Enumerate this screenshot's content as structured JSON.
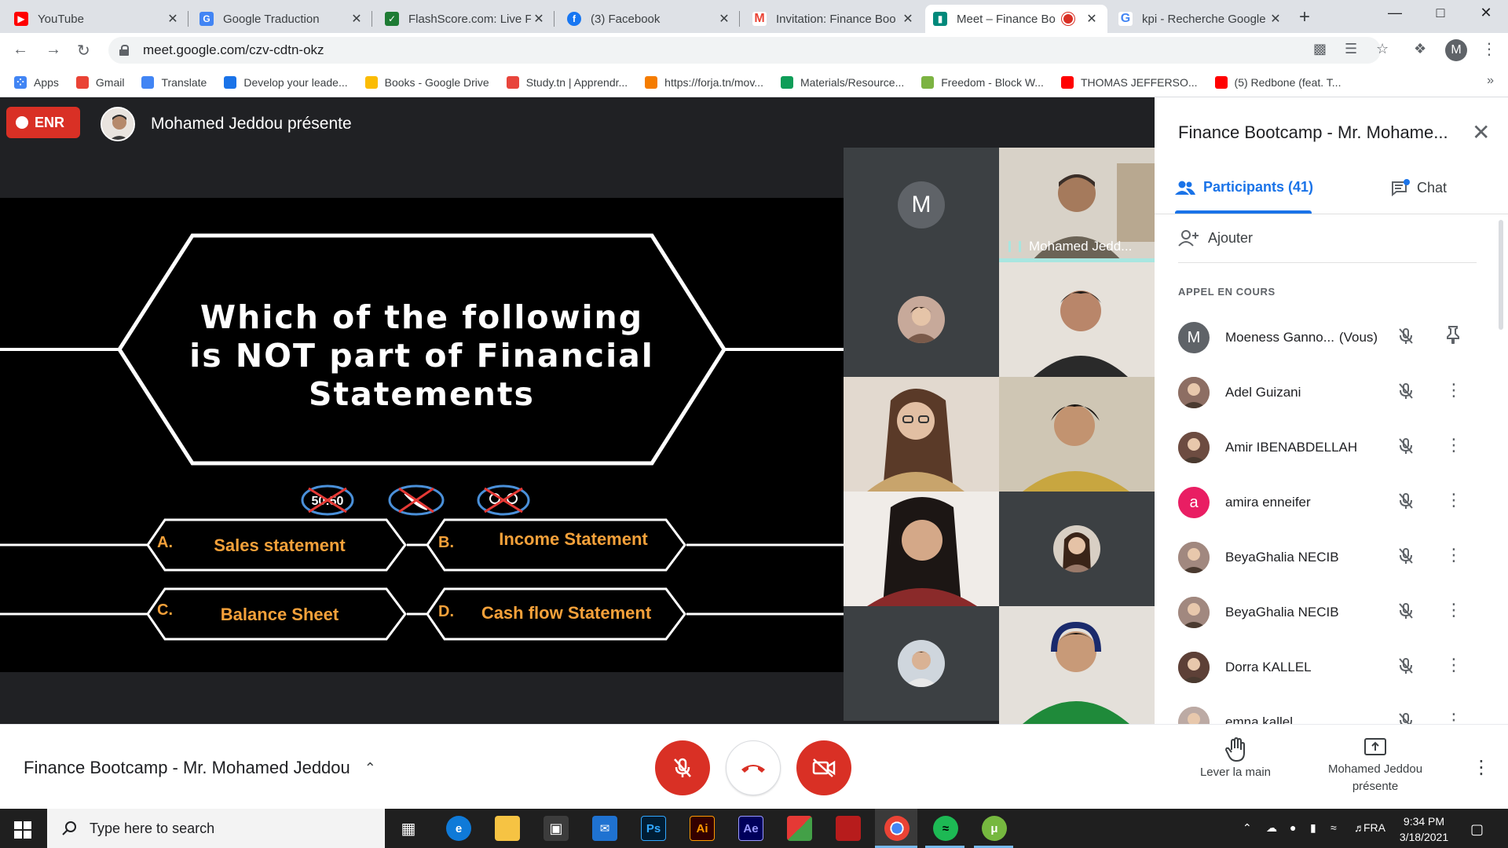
{
  "browser": {
    "tabs": [
      {
        "title": "YouTube",
        "icon": "youtube-icon",
        "color": "#ff0000"
      },
      {
        "title": "Google Traduction",
        "icon": "google-translate-icon",
        "color": "#4285f4"
      },
      {
        "title": "FlashScore.com: Live Fo",
        "icon": "flashscore-icon",
        "color": "#1e7b34"
      },
      {
        "title": "(3) Facebook",
        "icon": "facebook-icon",
        "color": "#1877f2"
      },
      {
        "title": "Invitation: Finance Boo",
        "icon": "gmail-icon",
        "color": "#ea4335"
      },
      {
        "title": "Meet – Finance Bo",
        "icon": "google-meet-icon",
        "color": "#00897b",
        "active": true,
        "recording": true
      },
      {
        "title": "kpi - Recherche Google",
        "icon": "google-icon",
        "color": "#4285f4"
      }
    ],
    "url": "meet.google.com/czv-cdtn-okz",
    "profile_initial": "M",
    "bookmarks": [
      {
        "label": "Apps",
        "icon": "apps-grid-icon",
        "color": "#4285f4"
      },
      {
        "label": "Gmail",
        "icon": "gmail-icon",
        "color": "#ea4335"
      },
      {
        "label": "Translate",
        "icon": "google-translate-icon",
        "color": "#4285f4"
      },
      {
        "label": "Develop your leade...",
        "icon": "develop-icon",
        "color": "#1a73e8"
      },
      {
        "label": "Books - Google Drive",
        "icon": "google-drive-icon",
        "color": "#fbbc04"
      },
      {
        "label": "Study.tn | Apprendr...",
        "icon": "study-icon",
        "color": "#e8453c"
      },
      {
        "label": "https://forja.tn/mov...",
        "icon": "forja-icon",
        "color": "#f57c00"
      },
      {
        "label": "Materials/Resource...",
        "icon": "materials-icon",
        "color": "#0f9d58"
      },
      {
        "label": "Freedom - Block W...",
        "icon": "freedom-icon",
        "color": "#7cb342"
      },
      {
        "label": "THOMAS JEFFERSO...",
        "icon": "youtube-icon",
        "color": "#ff0000"
      },
      {
        "label": "(5) Redbone (feat. T...",
        "icon": "youtube-icon",
        "color": "#ff0000"
      }
    ]
  },
  "meet": {
    "recording_label": "ENR",
    "presenting_text": "Mohamed Jeddou présente",
    "slide": {
      "question": "Which of the following is NOT part of Financial Statements",
      "lifelines": [
        "50:50"
      ],
      "answers": [
        {
          "letter": "A.",
          "text": "Sales statement"
        },
        {
          "letter": "B.",
          "text": "Income Statement"
        },
        {
          "letter": "C.",
          "text": "Balance Sheet"
        },
        {
          "letter": "D.",
          "text": "Cash flow Statement"
        }
      ]
    },
    "tiles": {
      "m_initial": "M",
      "speaker_name": "Mohamed Jedd..."
    },
    "panel": {
      "title": "Finance Bootcamp - Mr. Mohame...",
      "participants_tab": "Participants (41)",
      "chat_tab": "Chat",
      "add_label": "Ajouter",
      "section_label": "APPEL EN COURS",
      "participants": [
        {
          "name": "Moeness Ganno...",
          "suffix": "(Vous)",
          "avatar": "M",
          "avatar_color": "#5f6368",
          "action": "pin-icon"
        },
        {
          "name": "Adel Guizani",
          "avatar": "",
          "avatar_color": "#8d6e63",
          "action": "more-icon"
        },
        {
          "name": "Amir IBENABDELLAH",
          "avatar": "",
          "avatar_color": "#6d4c41",
          "action": "more-icon"
        },
        {
          "name": "amira enneifer",
          "avatar": "a",
          "avatar_color": "#e91e63",
          "action": "more-icon"
        },
        {
          "name": "BeyaGhalia NECIB",
          "avatar": "",
          "avatar_color": "#a1887f",
          "action": "more-icon"
        },
        {
          "name": "BeyaGhalia NECIB",
          "avatar": "",
          "avatar_color": "#a1887f",
          "action": "more-icon"
        },
        {
          "name": "Dorra KALLEL",
          "avatar": "",
          "avatar_color": "#5d4037",
          "action": "more-icon"
        },
        {
          "name": "emna kallel",
          "avatar": "",
          "avatar_color": "#bcaaa4",
          "action": "more-icon"
        }
      ]
    },
    "controls": {
      "meeting_name": "Finance Bootcamp - Mr. Mohamed Jeddou",
      "raise_hand": "Lever la main",
      "presenting_line1": "Mohamed Jeddou",
      "presenting_line2": "présente"
    }
  },
  "taskbar": {
    "search_placeholder": "Type here to search",
    "language": "FRA",
    "time": "9:34 PM",
    "date": "3/18/2021"
  },
  "colors": {
    "meet_red": "#d93025",
    "meet_blue": "#1a73e8",
    "slide_orange": "#f5a13a",
    "speaking_teal": "#a8e6e0"
  }
}
